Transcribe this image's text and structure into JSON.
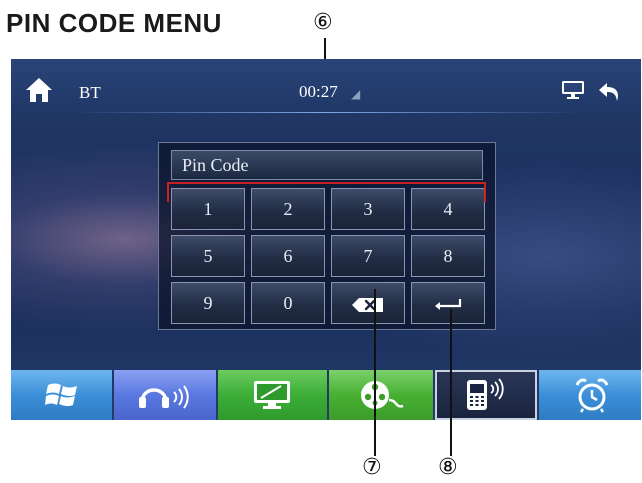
{
  "heading": "PIN CODE MENU",
  "callouts": {
    "c6": "⑥",
    "c7": "⑦",
    "c8": "⑧"
  },
  "status_bar": {
    "home_icon": "home-icon",
    "source": "BT",
    "time": "00:27",
    "display_icon": "display-icon",
    "back_icon": "back-arrow-icon"
  },
  "keypad": {
    "field_label": "Pin Code",
    "keys": [
      "1",
      "2",
      "3",
      "4",
      "5",
      "6",
      "7",
      "8",
      "9",
      "0"
    ],
    "backspace_icon": "backspace-icon",
    "enter_icon": "enter-icon"
  },
  "dock": {
    "items": [
      {
        "icon": "windows-icon",
        "color": "#3a8fd8"
      },
      {
        "icon": "headphones-icon",
        "color": "#5a78e0"
      },
      {
        "icon": "monitor-icon",
        "color": "#3cae38"
      },
      {
        "icon": "video-reel-icon",
        "color": "#48b033"
      },
      {
        "icon": "bt-phone-icon",
        "color": "#1f2a44"
      },
      {
        "icon": "alarm-clock-icon",
        "color": "#3a8fd8"
      }
    ]
  }
}
